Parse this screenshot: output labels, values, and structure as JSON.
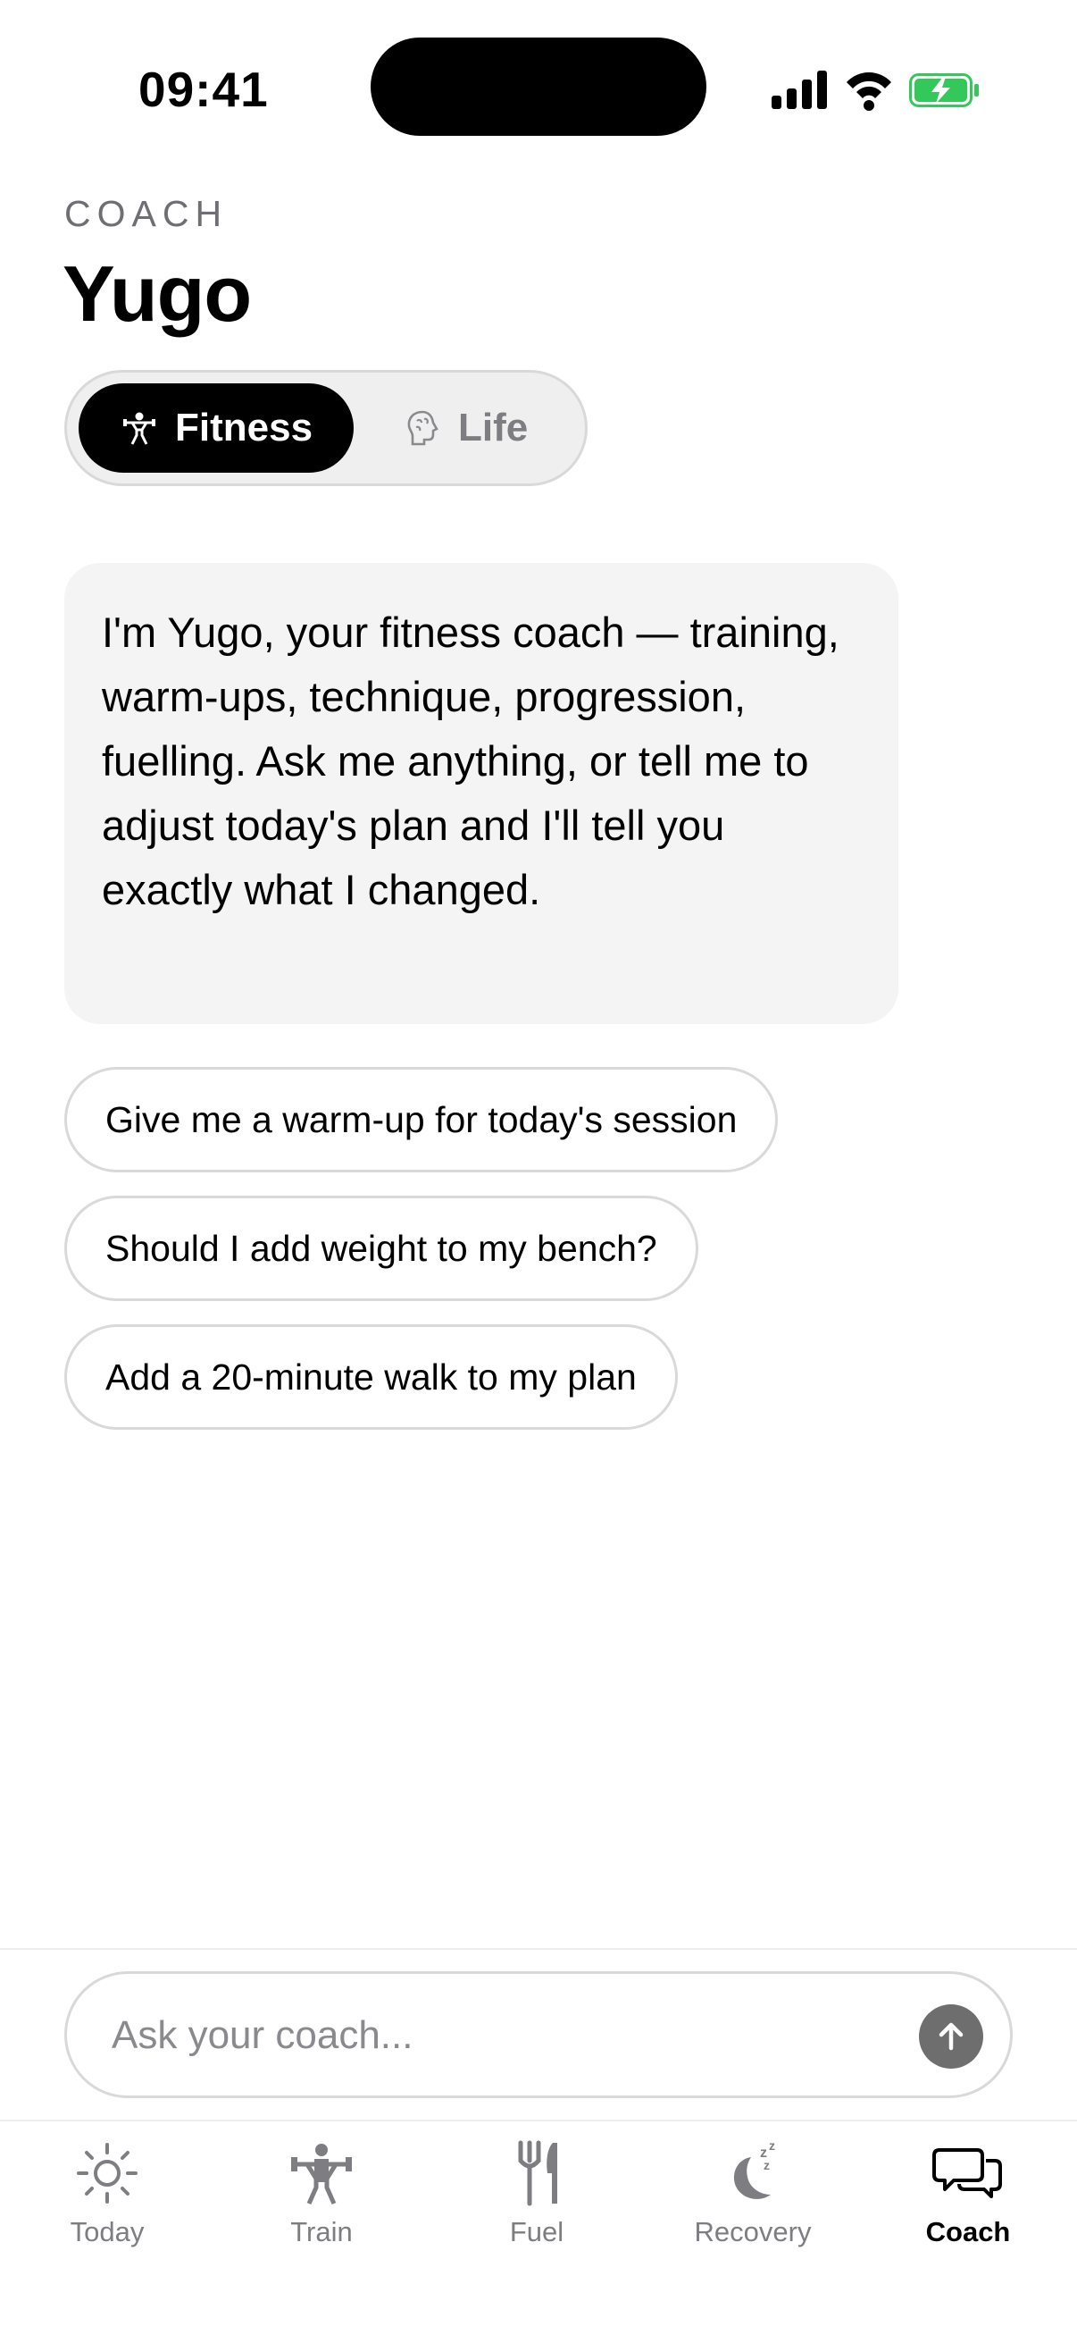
{
  "status_bar": {
    "time": "09:41",
    "icons": [
      "cellular-signal-icon",
      "wifi-icon",
      "battery-charging-icon"
    ],
    "battery_color": "#34c759"
  },
  "header": {
    "eyebrow": "COACH",
    "title": "Yugo"
  },
  "coach_toggle": {
    "options": [
      {
        "label": "Fitness",
        "icon": "weightlifter-icon",
        "selected": true
      },
      {
        "label": "Life",
        "icon": "brain-icon",
        "selected": false
      }
    ]
  },
  "chat": {
    "messages": [
      {
        "from": "coach",
        "text": "I'm Yugo, your fitness coach — training, warm-ups, technique, progression, fuelling. Ask me anything, or tell me to adjust today's plan and I'll tell you exactly what I changed."
      }
    ],
    "suggestions": [
      "Give me a warm-up for today's session",
      "Should I add weight to my bench?",
      "Add a 20-minute walk to my plan"
    ]
  },
  "composer": {
    "placeholder": "Ask your coach...",
    "value": "",
    "send_icon": "arrow-up-icon"
  },
  "tab_bar": {
    "tabs": [
      {
        "label": "Today",
        "icon": "sun-icon",
        "active": false
      },
      {
        "label": "Train",
        "icon": "weightlifter-icon",
        "active": false
      },
      {
        "label": "Fuel",
        "icon": "fork-knife-icon",
        "active": false
      },
      {
        "label": "Recovery",
        "icon": "moon-zzz-icon",
        "active": false
      },
      {
        "label": "Coach",
        "icon": "chat-bubbles-icon",
        "active": true
      }
    ]
  },
  "colors": {
    "accent": "#000000",
    "inactive": "#7d7d82",
    "bubble_bg": "#f4f4f4",
    "border": "#d9d9d9"
  }
}
